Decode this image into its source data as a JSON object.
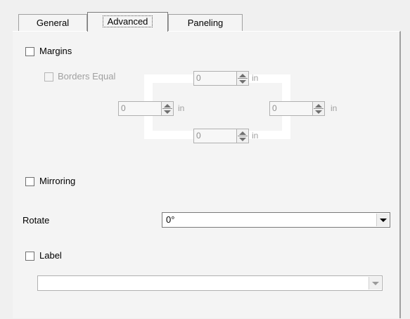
{
  "tabs": [
    {
      "label": "General",
      "active": false
    },
    {
      "label": "Advanced",
      "active": true
    },
    {
      "label": "Paneling",
      "active": false
    }
  ],
  "margins": {
    "label": "Margins",
    "checked": false,
    "borders_equal": {
      "label": "Borders Equal",
      "checked": false,
      "enabled": false
    },
    "top": {
      "value": "0",
      "unit": "in"
    },
    "left": {
      "value": "0",
      "unit": "in"
    },
    "right": {
      "value": "0",
      "unit": "in"
    },
    "bottom": {
      "value": "0",
      "unit": "in"
    }
  },
  "mirroring": {
    "label": "Mirroring",
    "checked": false
  },
  "rotate": {
    "label": "Rotate",
    "value": "0°"
  },
  "label_option": {
    "label": "Label",
    "checked": false,
    "value": ""
  }
}
